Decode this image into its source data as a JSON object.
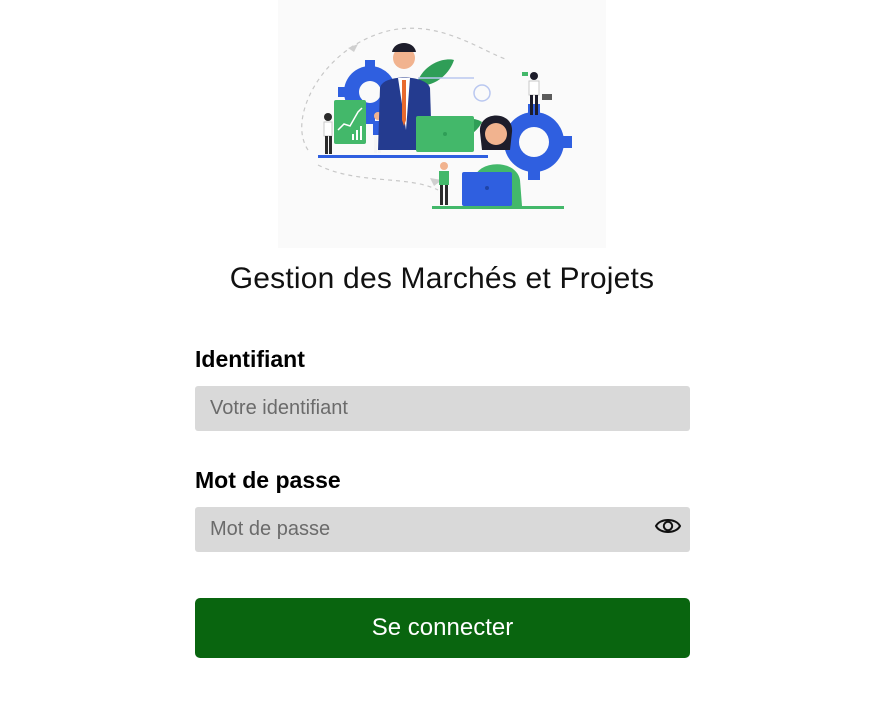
{
  "hero": {
    "illustration_name": "team-collaboration-illustration"
  },
  "app": {
    "title": "Gestion des Marchés et Projets"
  },
  "form": {
    "username": {
      "label": "Identifiant",
      "placeholder": "Votre identifiant",
      "value": ""
    },
    "password": {
      "label": "Mot de passe",
      "placeholder": "Mot de passe",
      "value": "",
      "toggle_icon": "eye-icon"
    },
    "submit_label": "Se connecter"
  },
  "colors": {
    "primary_button": "#09650f",
    "input_background": "#d9d9d9",
    "illustration_blue": "#2f5fe0",
    "illustration_green": "#43b86a"
  }
}
